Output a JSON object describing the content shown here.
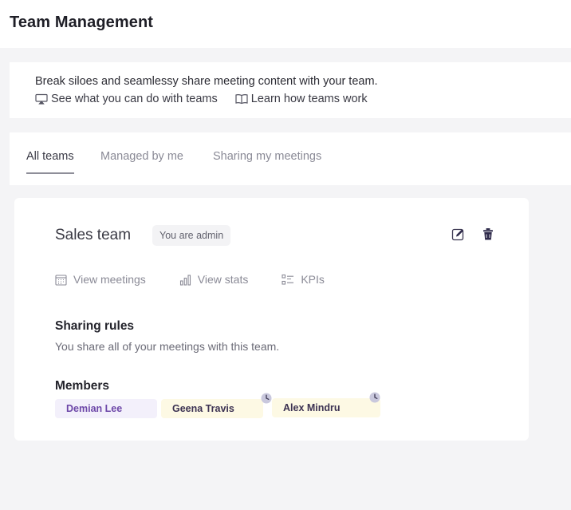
{
  "header": {
    "title": "Team Management"
  },
  "info": {
    "text": "Break siloes and seamlessy share meeting content with your team.",
    "links": [
      {
        "label": "See what you can do with teams",
        "icon": "screen-icon"
      },
      {
        "label": "Learn how teams work",
        "icon": "book-icon"
      }
    ]
  },
  "tabs": [
    {
      "label": "All teams",
      "active": true
    },
    {
      "label": "Managed by me",
      "active": false
    },
    {
      "label": "Sharing my meetings",
      "active": false
    }
  ],
  "team": {
    "name": "Sales team",
    "badge": "You are admin",
    "actions": [
      {
        "label": "Edit",
        "icon": "edit-icon"
      },
      {
        "label": "Delete",
        "icon": "trash-icon"
      }
    ],
    "links": [
      {
        "label": "View meetings",
        "icon": "calendar-icon"
      },
      {
        "label": "View stats",
        "icon": "bar-chart-icon"
      },
      {
        "label": "KPIs",
        "icon": "checklist-icon"
      }
    ],
    "sharing_title": "Sharing rules",
    "sharing_text": "You share all of your meetings with this team.",
    "members_title": "Members",
    "members": [
      {
        "name": "Demian Lee",
        "color": "#f3f0fb",
        "text_color": "#6d47a8",
        "pending": false
      },
      {
        "name": "Geena Travis",
        "color": "#fdf9e4",
        "text_color": "#3c3252",
        "pending": true
      },
      {
        "name": "Alex Mindru",
        "color": "#fdf9e4",
        "text_color": "#3c3252",
        "pending": true
      }
    ]
  },
  "colors": {
    "accent": "#8e8e99",
    "background": "#f4f4f6",
    "member_violet": "#6d47a8",
    "icon_dark": "#2e2a4a"
  }
}
